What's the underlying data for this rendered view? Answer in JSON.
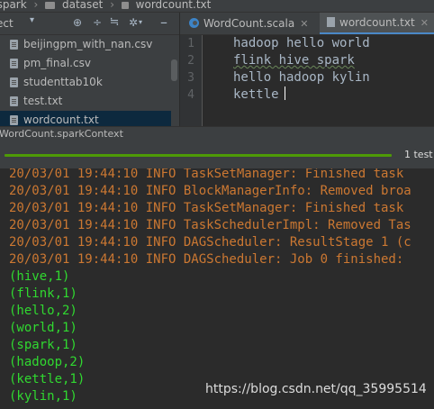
{
  "breadcrumb": {
    "items": [
      "s-spark",
      "dataset",
      "wordcount.txt"
    ]
  },
  "project_panel": {
    "title": "ect",
    "files": [
      {
        "name": "beijingpm_with_nan.csv",
        "selected": false
      },
      {
        "name": "pm_final.csv",
        "selected": false
      },
      {
        "name": "studenttab10k",
        "selected": false
      },
      {
        "name": "test.txt",
        "selected": false
      },
      {
        "name": "wordcount.txt",
        "selected": true
      }
    ]
  },
  "editor": {
    "tabs": [
      {
        "label": "WordCount.scala",
        "active": false
      },
      {
        "label": "wordcount.txt",
        "active": true
      }
    ],
    "line_numbers": [
      "1",
      "2",
      "3",
      "4"
    ],
    "lines": [
      "hadoop hello world",
      "flink hive spark",
      "hello hadoop kylin",
      "kettle"
    ]
  },
  "status_bar": {
    "text": "WordCount.sparkContext"
  },
  "run_panel": {
    "test_count": "1 test",
    "progress_fraction": 1.0,
    "progress_color": "#4e9a06"
  },
  "console": {
    "info_lines": [
      "20/03/01 19:44:10 INFO TaskSetManager: Finished task",
      "20/03/01 19:44:10 INFO BlockManagerInfo: Removed broa",
      "20/03/01 19:44:10 INFO TaskSetManager: Finished task",
      "20/03/01 19:44:10 INFO TaskSchedulerImpl: Removed Tas",
      "20/03/01 19:44:10 INFO DAGScheduler: ResultStage 1 (c",
      "20/03/01 19:44:10 INFO DAGScheduler: Job 0 finished:"
    ],
    "output_lines": [
      "(hive,1)",
      "(flink,1)",
      "(hello,2)",
      "(world,1)",
      "(spark,1)",
      "(hadoop,2)",
      "(kettle,1)",
      "(kylin,1)"
    ],
    "colors": {
      "info": "#cc7832",
      "output": "#30d930"
    }
  },
  "watermark": "https://blog.csdn.net/qq_35995514"
}
